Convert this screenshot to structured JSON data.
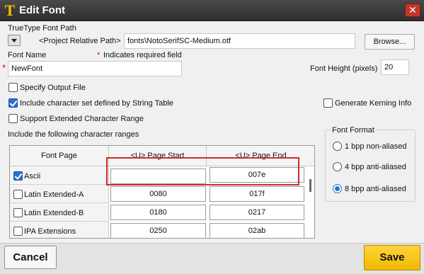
{
  "window": {
    "title": "Edit Font",
    "logo_letter": "T",
    "close_glyph": "✕"
  },
  "font_path": {
    "label": "TrueType Font Path",
    "prefix": "<Project Relative Path>",
    "value": "fonts\\NotoSerifSC-Medium.otf",
    "browse_label": "Browse..."
  },
  "font_name": {
    "label": "Font Name",
    "required_star": "*",
    "required_note": "Indicates required field",
    "value": "NewFont"
  },
  "font_height": {
    "label": "Font Height (pixels)",
    "value": "20"
  },
  "options": {
    "specify_output_file": {
      "label": "Specify Output File",
      "checked": false
    },
    "include_string_table": {
      "label": "Include character set defined by String Table",
      "checked": true
    },
    "extended_range": {
      "label": "Support Extended Character Range",
      "checked": false
    },
    "kerning": {
      "label": "Generate Kerning Info",
      "checked": false
    }
  },
  "ranges": {
    "label": "Include the following character ranges",
    "headers": {
      "font_page": "Font Page",
      "page_start": "<U> Page Start",
      "page_end": "<U> Page End"
    },
    "rows": [
      {
        "name": "Ascii",
        "checked": true,
        "start": "",
        "end": "007e"
      },
      {
        "name": "Latin Extended-A",
        "checked": false,
        "start": "0080",
        "end": "017f"
      },
      {
        "name": "Latin Extended-B",
        "checked": false,
        "start": "0180",
        "end": "0217"
      },
      {
        "name": "IPA Extensions",
        "checked": false,
        "start": "0250",
        "end": "02ab"
      }
    ]
  },
  "font_format": {
    "label": "Font Format",
    "options": [
      {
        "label": "1 bpp non-aliased",
        "selected": false
      },
      {
        "label": "4 bpp anti-aliased",
        "selected": false
      },
      {
        "label": "8 bpp anti-aliased",
        "selected": true
      }
    ]
  },
  "footer": {
    "cancel_label": "Cancel",
    "save_label": "Save"
  },
  "colors": {
    "accent_blue": "#2b6fd1",
    "save_yellow": "#f0b800",
    "highlight_red": "#d22a2a",
    "close_red": "#c3362b",
    "titlebar": "#3a3a3a"
  }
}
